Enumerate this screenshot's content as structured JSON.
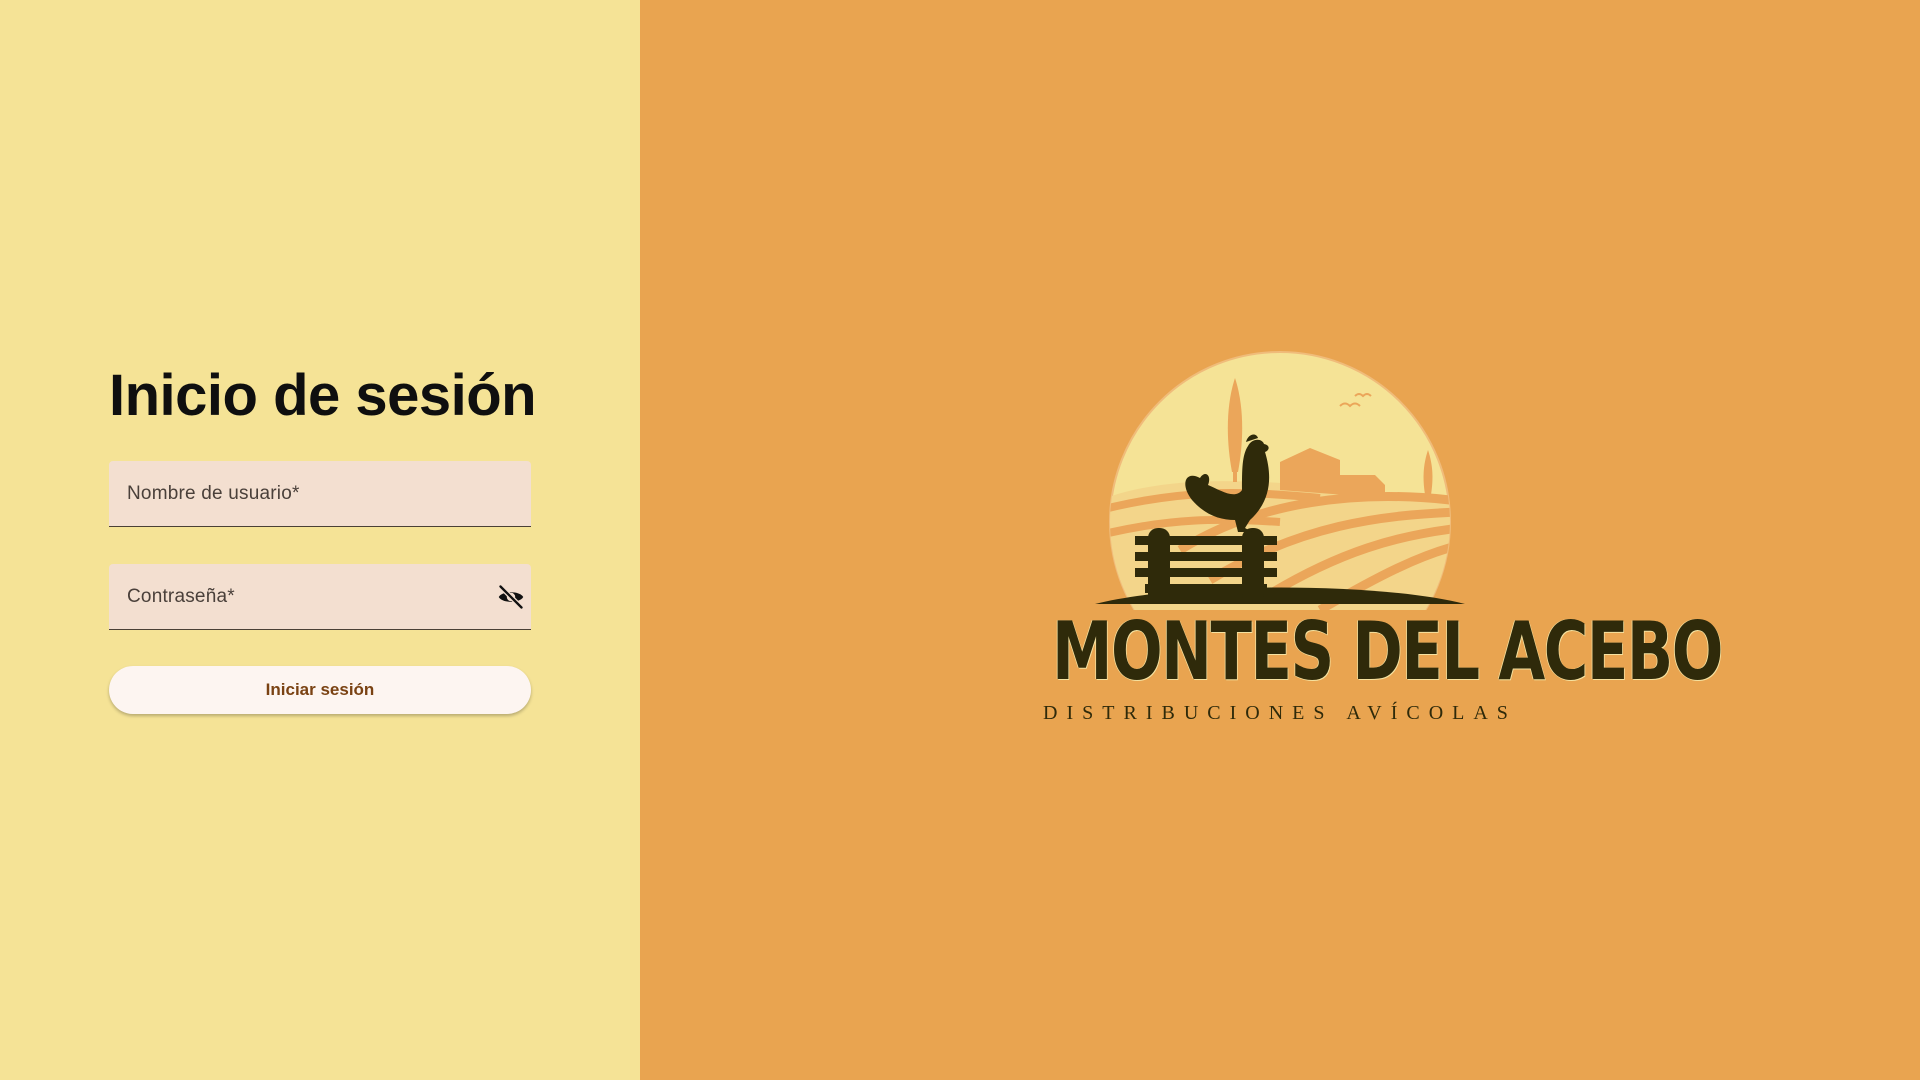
{
  "colors": {
    "left_panel_bg": "#f5e396",
    "right_panel_bg": "#e9a450",
    "field_bg": "#f3dfd0",
    "button_bg": "#fdf5f1",
    "button_text": "#7a4213",
    "brand_dark": "#2f2a0a"
  },
  "login": {
    "title": "Inicio de sesión",
    "username_label": "Nombre de usuario*",
    "password_label": "Contraseña*",
    "password_toggle_icon": "eye-off-icon",
    "submit_label": "Iniciar sesión"
  },
  "brand": {
    "name": "MONTES DEL ACEBO",
    "tagline": "DISTRIBUCIONES AVÍCOLAS",
    "emblem_icon": "rooster-farm-emblem"
  }
}
